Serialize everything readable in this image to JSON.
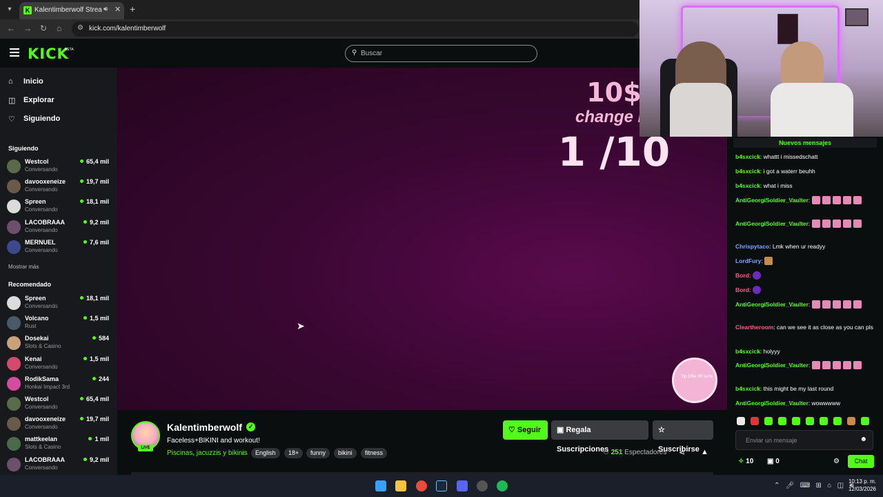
{
  "browser": {
    "tab_title": "Kalentimberwolf Stream - V",
    "url": "kick.com/kalentimberwolf",
    "tab_close": "✕",
    "new_tab": "+"
  },
  "header": {
    "logo": "KICK",
    "beta": "BETA",
    "search_placeholder": "Buscar"
  },
  "sidebar": {
    "nav": [
      {
        "label": "Inicio",
        "icon": "home-icon"
      },
      {
        "label": "Explorar",
        "icon": "compass-icon"
      },
      {
        "label": "Siguiendo",
        "icon": "heart-icon"
      }
    ],
    "following_title": "Siguiendo",
    "following": [
      {
        "name": "Westcol",
        "category": "Conversando",
        "viewers": "65,4 mil",
        "color": "#5a6b4a"
      },
      {
        "name": "davooxeneize",
        "category": "Conversando",
        "viewers": "19,7 mil",
        "color": "#6a5a4a"
      },
      {
        "name": "Spreen",
        "category": "Conversando",
        "viewers": "18,1 mil",
        "color": "#dcdcdc"
      },
      {
        "name": "LACOBRAAA",
        "category": "Conversando",
        "viewers": "9,2 mil",
        "color": "#6b4f6b"
      },
      {
        "name": "MERNUEL",
        "category": "Conversando",
        "viewers": "7,6 mil",
        "color": "#3a4a8a"
      }
    ],
    "show_more": "Mostrar más",
    "recommended_title": "Recomendado",
    "recommended": [
      {
        "name": "Spreen",
        "category": "Conversando",
        "viewers": "18,1 mil",
        "color": "#dcdcdc"
      },
      {
        "name": "Volcano",
        "category": "Rust",
        "viewers": "1,5 mil",
        "color": "#4a5a6a"
      },
      {
        "name": "Dosekai",
        "category": "Slots & Casino",
        "viewers": "584",
        "color": "#c9a27a"
      },
      {
        "name": "Kenai",
        "category": "Conversando",
        "viewers": "1,5 mil",
        "color": "#d44a6a"
      },
      {
        "name": "RodikSama",
        "category": "Honkai Impact 3rd",
        "viewers": "244",
        "color": "#d64aa0"
      },
      {
        "name": "Westcol",
        "category": "Conversando",
        "viewers": "65,4 mil",
        "color": "#5a6b4a"
      },
      {
        "name": "davooxeneize",
        "category": "Conversando",
        "viewers": "19,7 mil",
        "color": "#6a5a4a"
      },
      {
        "name": "mattkeelan",
        "category": "Slots & Casino",
        "viewers": "1 mil",
        "color": "#4a6a4a"
      },
      {
        "name": "LACOBRAAA",
        "category": "Conversando",
        "viewers": "9,2 mil",
        "color": "#6b4f6b"
      }
    ]
  },
  "video": {
    "promo_top": "10$",
    "promo_mid": "change in",
    "promo_bot": "1 /10",
    "paw_label": "Tip Offer 95 subs"
  },
  "channel": {
    "name": "Kalentimberwolf",
    "live": "LIVE",
    "title": "Faceless+BIKINI and workout!",
    "category": "Piscinas, jacuzzis y bikinis",
    "tags": [
      "English",
      "18+",
      "funny",
      "bikini",
      "fitness"
    ],
    "follow": "Seguir",
    "gift": "Regala Suscripciones",
    "subscribe": "Suscribirse",
    "viewers": "251",
    "viewers_label": "Espectadores"
  },
  "chat": {
    "new_messages": "Nuevos mensajes",
    "messages": [
      {
        "user": "b4sxcick",
        "color": "#53fc18",
        "text": ": whattt i missedschatt"
      },
      {
        "user": "b4sxcick",
        "color": "#53fc18",
        "text": ": i got a waterr beuhh"
      },
      {
        "user": "b4sxcick",
        "color": "#53fc18",
        "text": ": what i miss"
      },
      {
        "user": "AntiGeorgiSoldier_Vaulter",
        "color": "#53fc18",
        "text": ":",
        "emotes": 5
      },
      {
        "user": "AntiGeorgiSoldier_Vaulter",
        "color": "#53fc18",
        "text": ":",
        "emotes": 5
      },
      {
        "user": "Chrispytaco",
        "color": "#7aa7ff",
        "text": ": Lmk when ur readyy"
      },
      {
        "user": "LordFury",
        "color": "#7aa7ff",
        "text": ":",
        "emotes": 1
      },
      {
        "user": "Bord",
        "color": "#ff5a8a",
        "text": ":",
        "emotes": 1
      },
      {
        "user": "Bord",
        "color": "#ff5a8a",
        "text": ":",
        "emotes": 1
      },
      {
        "user": "AntiGeorgiSoldier_Vaulter",
        "color": "#53fc18",
        "text": ":",
        "emotes": 5
      },
      {
        "user": "Cleartheroom",
        "color": "#ff5a8a",
        "text": ": can we see it as close as you can pls"
      },
      {
        "user": "b4sxcick",
        "color": "#53fc18",
        "text": ": holyyy"
      },
      {
        "user": "AntiGeorgiSoldier_Vaulter",
        "color": "#53fc18",
        "text": ":",
        "emotes": 5
      },
      {
        "user": "b4sxcick",
        "color": "#53fc18",
        "text": ": this might be my last round"
      },
      {
        "user": "AntiGeorgiSoldier_Vaulter",
        "color": "#53fc18",
        "text": ": wowwwww"
      }
    ],
    "input_placeholder": "Enviar un mensaje",
    "points": "10",
    "gifts": "0",
    "send_label": "Chat"
  },
  "taskbar": {
    "time": "10:13 p. m.",
    "date": "12/03/2026"
  }
}
